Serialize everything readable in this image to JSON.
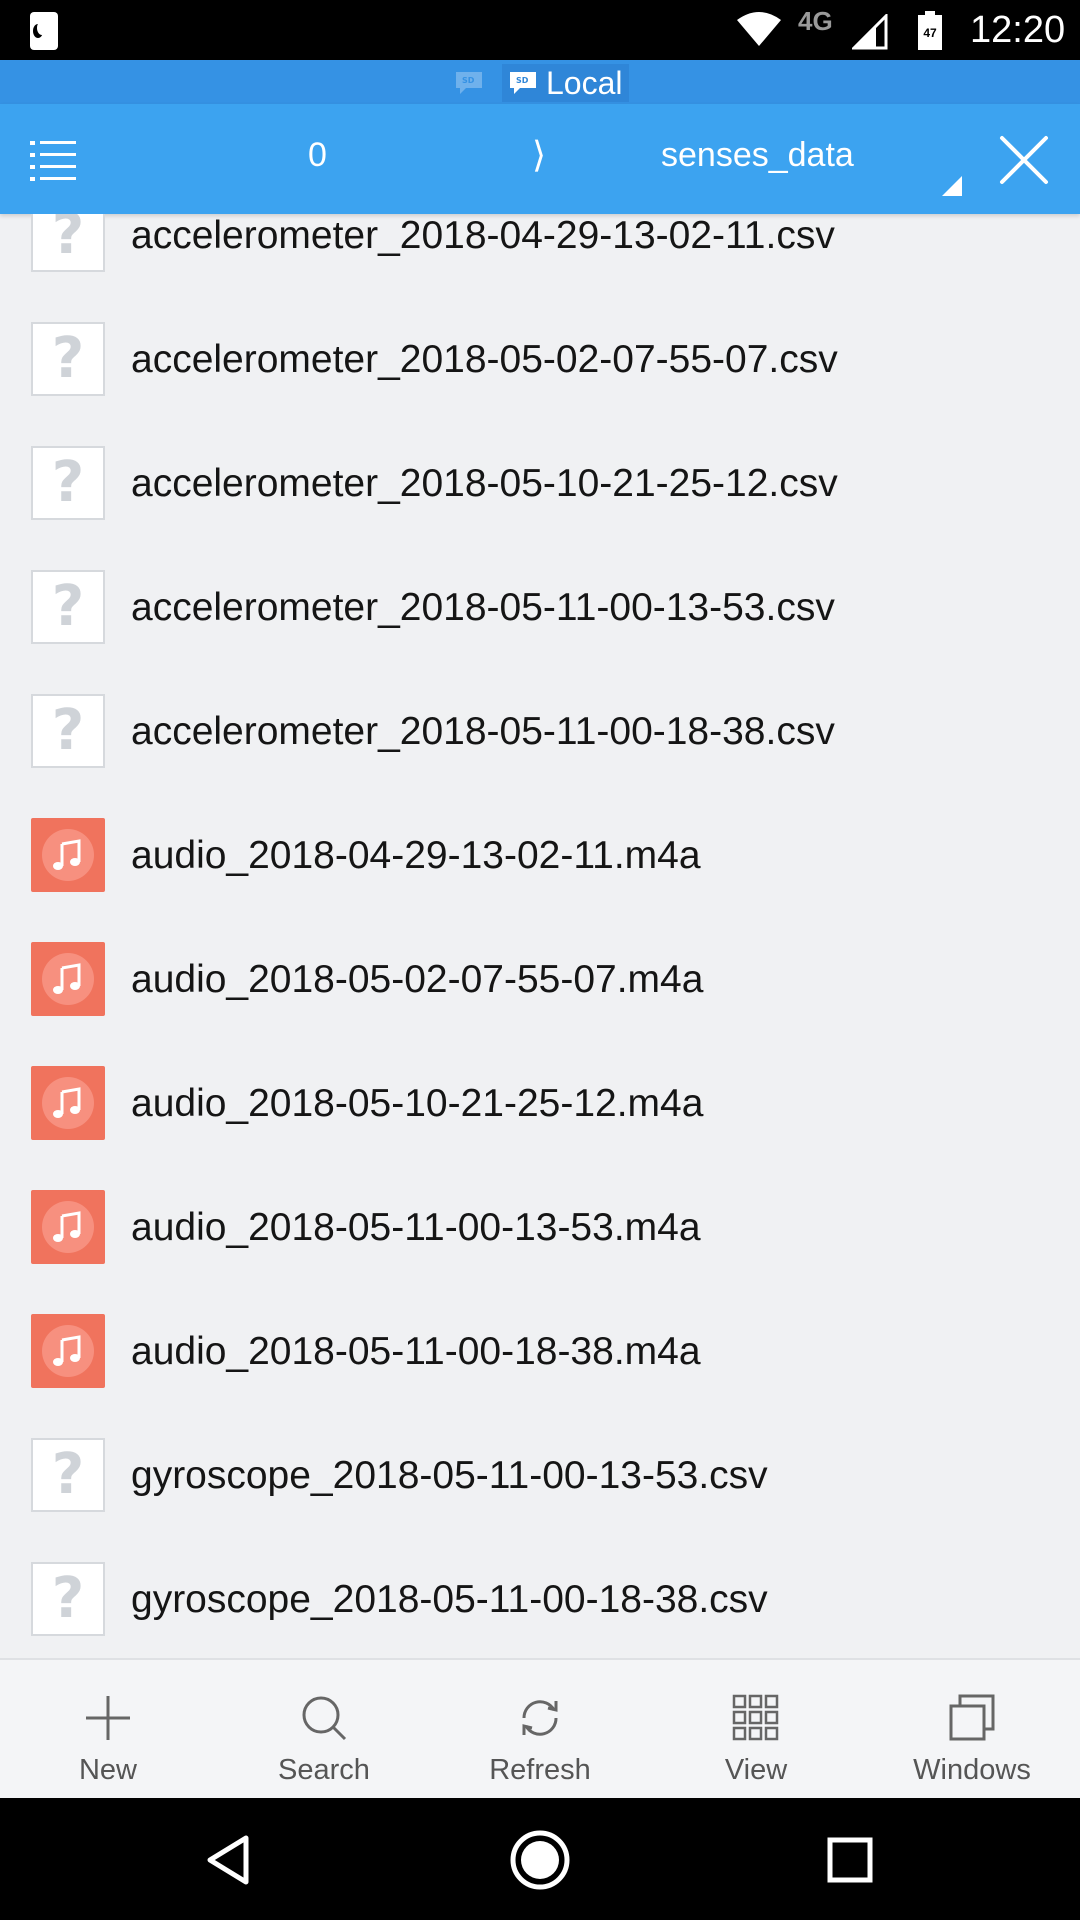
{
  "status_bar": {
    "network_type": "4G",
    "battery_level": "47",
    "time": "12:20"
  },
  "storage": {
    "label": "Local"
  },
  "toolbar": {
    "path_count": "0",
    "separator": "⟩",
    "folder_name": "senses_data"
  },
  "files": [
    {
      "name": "accelerometer_2018-04-29-13-02-11.csv",
      "type": "unknown"
    },
    {
      "name": "accelerometer_2018-05-02-07-55-07.csv",
      "type": "unknown"
    },
    {
      "name": "accelerometer_2018-05-10-21-25-12.csv",
      "type": "unknown"
    },
    {
      "name": "accelerometer_2018-05-11-00-13-53.csv",
      "type": "unknown"
    },
    {
      "name": "accelerometer_2018-05-11-00-18-38.csv",
      "type": "unknown"
    },
    {
      "name": "audio_2018-04-29-13-02-11.m4a",
      "type": "audio"
    },
    {
      "name": "audio_2018-05-02-07-55-07.m4a",
      "type": "audio"
    },
    {
      "name": "audio_2018-05-10-21-25-12.m4a",
      "type": "audio"
    },
    {
      "name": "audio_2018-05-11-00-13-53.m4a",
      "type": "audio"
    },
    {
      "name": "audio_2018-05-11-00-18-38.m4a",
      "type": "audio"
    },
    {
      "name": "gyroscope_2018-05-11-00-13-53.csv",
      "type": "unknown"
    },
    {
      "name": "gyroscope_2018-05-11-00-18-38.csv",
      "type": "unknown"
    }
  ],
  "bottom_toolbar": {
    "new_label": "New",
    "search_label": "Search",
    "refresh_label": "Refresh",
    "view_label": "View",
    "windows_label": "Windows"
  },
  "colors": {
    "toolbar": "#3ca3f0",
    "storage_bar": "#3592e4",
    "audio_icon": "#f0735d"
  }
}
